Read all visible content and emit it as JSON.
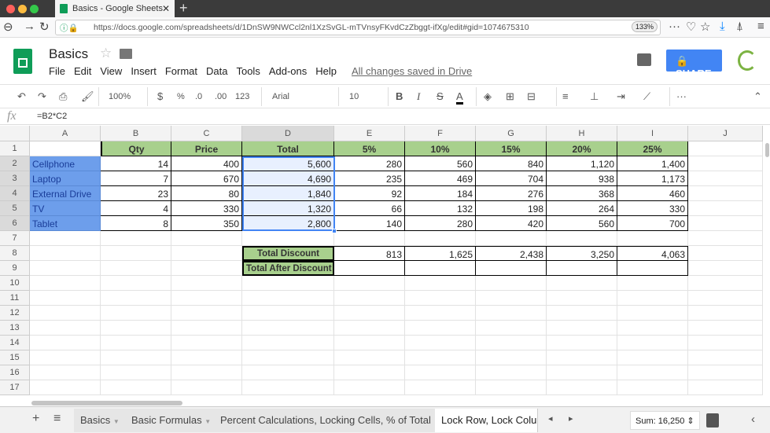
{
  "browser": {
    "tab_title": "Basics - Google Sheets",
    "url": "https://docs.google.com/spreadsheets/d/1DnSW9NWCcl2nl1XzSvGL-mTVnsyFKvdCzZbggt-ifXg/edit#gid=1074675310",
    "zoom": "133%"
  },
  "doc": {
    "title": "Basics",
    "menu": [
      "File",
      "Edit",
      "View",
      "Insert",
      "Format",
      "Data",
      "Tools",
      "Add-ons",
      "Help"
    ],
    "saved_status": "All changes saved in Drive",
    "share_label": "SHARE"
  },
  "toolbar": {
    "zoom": "100%",
    "currency": "$",
    "percent": "%",
    "dec_less": ".0",
    "dec_more": ".00",
    "format": "123",
    "font": "Arial",
    "size": "10"
  },
  "formula": {
    "fx": "fx",
    "value": "=B2*C2"
  },
  "columns": [
    "A",
    "B",
    "C",
    "D",
    "E",
    "F",
    "G",
    "H",
    "I",
    "J"
  ],
  "rows": [
    [
      "",
      "Qty",
      "Price",
      "Total",
      "5%",
      "10%",
      "15%",
      "20%",
      "25%",
      ""
    ],
    [
      "Cellphone",
      "14",
      "400",
      "5,600",
      "280",
      "560",
      "840",
      "1,120",
      "1,400",
      ""
    ],
    [
      "Laptop",
      "7",
      "670",
      "4,690",
      "235",
      "469",
      "704",
      "938",
      "1,173",
      ""
    ],
    [
      "External Drive",
      "23",
      "80",
      "1,840",
      "92",
      "184",
      "276",
      "368",
      "460",
      ""
    ],
    [
      "TV",
      "4",
      "330",
      "1,320",
      "66",
      "132",
      "198",
      "264",
      "330",
      ""
    ],
    [
      "Tablet",
      "8",
      "350",
      "2,800",
      "140",
      "280",
      "420",
      "560",
      "700",
      ""
    ],
    [
      "",
      "",
      "",
      "",
      "",
      "",
      "",
      "",
      "",
      ""
    ],
    [
      "",
      "",
      "",
      "Total Discount",
      "813",
      "1,625",
      "2,438",
      "3,250",
      "4,063",
      ""
    ],
    [
      "",
      "",
      "",
      "Total After Discount",
      "",
      "",
      "",
      "",
      "",
      ""
    ]
  ],
  "row_count": 17,
  "sheets": [
    "Basics",
    "Basic Formulas",
    "Percent Calculations, Locking Cells, % of Total",
    "Lock Row, Lock Colum"
  ],
  "status": {
    "sum": "Sum: 16,250"
  }
}
